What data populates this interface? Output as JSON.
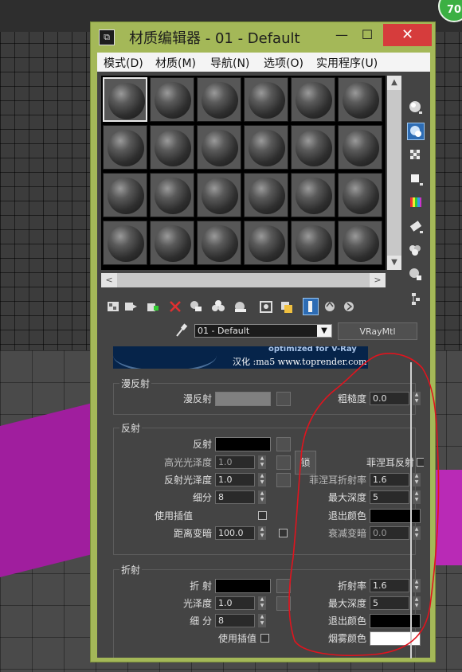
{
  "window": {
    "title": "材质编辑器 - 01 - Default",
    "app_icon_glyph": "⧉",
    "minimize_glyph": "—",
    "maximize_glyph": "☐",
    "close_glyph": "✕"
  },
  "corner_badge": "70",
  "menu": [
    "模式(D)",
    "材质(M)",
    "导航(N)",
    "选项(O)",
    "实用程序(U)"
  ],
  "slots": {
    "rows": 4,
    "cols": 6,
    "active_index": 0
  },
  "slot_scroll": {
    "up": "▲",
    "down": "▼",
    "left": "<",
    "right": ">"
  },
  "right_tools": [
    "sample-type-sphere-icon",
    "backlight-icon",
    "background-checker-icon",
    "sample-uv-tiling-icon",
    "video-color-check-icon",
    "make-preview-icon",
    "options-icon",
    "select-by-material-icon",
    "material-map-navigator-icon"
  ],
  "bottom_tools": [
    "get-material-icon",
    "put-to-scene-icon",
    "assign-to-selection-icon",
    "delete-icon",
    "make-unique-icon",
    "copy-material-icon",
    "put-to-library-icon",
    "material-id-channel-icon",
    "show-in-viewport-icon",
    "show-end-result-icon",
    "go-to-parent-icon",
    "go-forward-to-sibling-icon"
  ],
  "material": {
    "name": "01 - Default",
    "type": "VRayMtl",
    "dropdown_glyph": "▼"
  },
  "banner": {
    "line1": "optimized for V-Ray",
    "line2": "汉化 :ma5 www.toprender.com"
  },
  "diffuse": {
    "group_label": "漫反射",
    "diffuse_label": "漫反射",
    "roughness_label": "粗糙度",
    "roughness_value": "0.0",
    "diffuse_color": "#808080"
  },
  "reflection": {
    "group_label": "反射",
    "reflect_label": "反射",
    "reflect_color": "#000000",
    "hilight_gloss_label": "高光光泽度",
    "hilight_gloss_value": "1.0",
    "lock_label": "锁",
    "fresnel_label": "菲涅耳反射",
    "refl_gloss_label": "反射光泽度",
    "refl_gloss_value": "1.0",
    "fresnel_ior_label": "菲涅耳折射率",
    "fresnel_ior_value": "1.6",
    "subdivs_label": "细分",
    "subdivs_value": "8",
    "max_depth_label": "最大深度",
    "max_depth_value": "5",
    "use_interp_label": "使用插值",
    "exit_color_label": "退出颜色",
    "exit_color": "#000000",
    "dim_distance_label": "距离变暗",
    "dim_distance_value": "100.0",
    "dim_falloff_label": "衰减变暗",
    "dim_falloff_value": "0.0"
  },
  "refraction": {
    "group_label": "折射",
    "refract_label": "折 射",
    "refract_color": "#000000",
    "ior_label": "折射率",
    "ior_value": "1.6",
    "gloss_label": "光泽度",
    "gloss_value": "1.0",
    "max_depth_label": "最大深度",
    "max_depth_value": "5",
    "subdivs_label": "细 分",
    "subdivs_value": "8",
    "exit_color_label": "退出颜色",
    "exit_color": "#000000",
    "use_interp_label": "使用插值",
    "fog_color_label": "烟雾颜色",
    "fog_color": "#ffffff"
  },
  "colors": {
    "window_frame": "#a4b858",
    "close_button": "#d63c3c",
    "annotation": "#e0141e",
    "viewport_object": "#a01e9e"
  }
}
